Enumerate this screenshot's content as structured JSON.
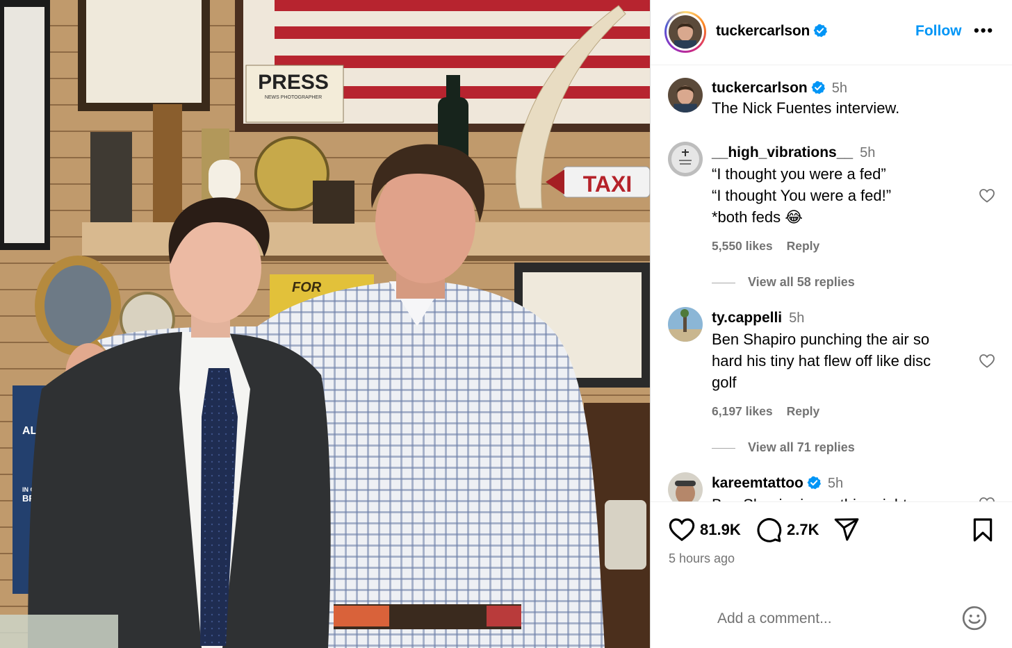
{
  "post": {
    "username": "tuckercarlson",
    "follow_label": "Follow",
    "more_label": "•••",
    "caption": {
      "username": "tuckercarlson",
      "time": "5h",
      "text": "The Nick Fuentes interview."
    }
  },
  "photo": {
    "signs": {
      "press": "PRESS",
      "press_sub": "NEWS PHOTOGRAPHER",
      "taxi": "TAXI",
      "for": "FOR",
      "alp": "ALP",
      "in_case": "IN CASE",
      "brea": "BREA"
    }
  },
  "comments": [
    {
      "username": "__high_vibrations__",
      "time": "5h",
      "lines": [
        "“I thought you were a fed”",
        "“I thought You were a fed!”",
        "*both feds 😂"
      ],
      "likes": "5,550 likes",
      "reply_label": "Reply",
      "view_replies": "View all 58 replies"
    },
    {
      "username": "ty.cappelli",
      "time": "5h",
      "lines": [
        "Ben Shapiro punching the air so",
        "hard his tiny hat flew off like disc",
        "golf"
      ],
      "likes": "6,197 likes",
      "reply_label": "Reply",
      "view_replies": "View all 71 replies"
    },
    {
      "username": "kareemtattoo",
      "time": "5h",
      "lines": [
        "Ben Shapiro is seething right now"
      ]
    }
  ],
  "actions": {
    "likes": "81.9K",
    "comments": "2.7K",
    "time_ago": "5 hours ago",
    "comment_placeholder": "Add a comment..."
  },
  "icons": {
    "like": "heart-icon",
    "comment": "comment-bubble-icon",
    "share": "paper-plane-icon",
    "save": "bookmark-icon",
    "verified": "verified-badge-icon",
    "emoji": "smiley-icon"
  },
  "colors": {
    "follow": "#0095f6",
    "verified": "#0095f6",
    "secondary_text": "#737373"
  }
}
